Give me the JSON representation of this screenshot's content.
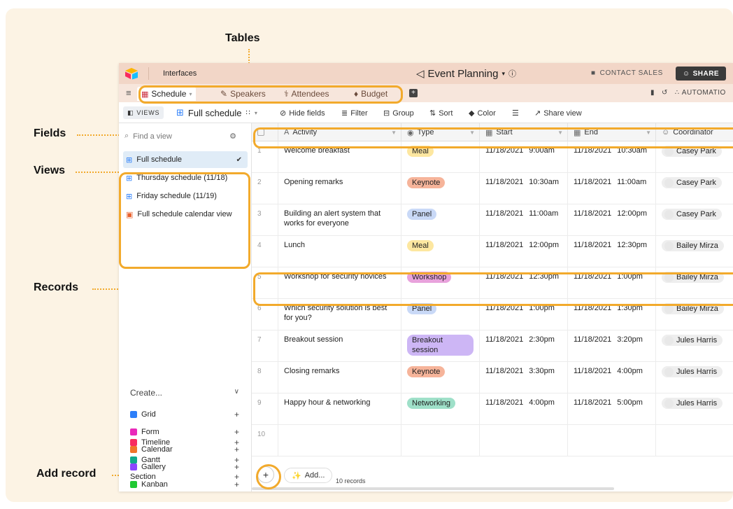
{
  "annotations": {
    "tables": "Tables",
    "fields": "Fields",
    "views": "Views",
    "records": "Records",
    "add_record": "Add record"
  },
  "header": {
    "interfaces": "Interfaces",
    "base_name": "Event Planning",
    "contact_sales": "CONTACT SALES",
    "share": "SHARE"
  },
  "tables": [
    "Schedule",
    "Speakers",
    "Attendees",
    "Budget"
  ],
  "toolbar_right": {
    "automations": "AUTOMATIO"
  },
  "viewbar": {
    "views": "VIEWS",
    "view_name": "Full schedule",
    "hide_fields": "Hide fields",
    "filter": "Filter",
    "group": "Group",
    "sort": "Sort",
    "color": "Color",
    "share_view": "Share view"
  },
  "sidebar": {
    "find_placeholder": "Find a view",
    "views": [
      "Full schedule",
      "Thursday schedule (11/18)",
      "Friday schedule (11/19)",
      "Full schedule calendar view"
    ],
    "create_label": "Create...",
    "create_items": [
      "Grid",
      "Form",
      "Calendar",
      "Gallery",
      "Kanban",
      "Timeline",
      "Gantt",
      "Section"
    ]
  },
  "columns": [
    "Activity",
    "Type",
    "Start",
    "End",
    "Coordinator"
  ],
  "rows": [
    {
      "n": "1",
      "activity": "Welcome breakfast",
      "type": "Meal",
      "start_d": "11/18/2021",
      "start_t": "9:00am",
      "end_d": "11/18/2021",
      "end_t": "10:30am",
      "coord": "Casey Park"
    },
    {
      "n": "2",
      "activity": "Opening remarks",
      "type": "Keynote",
      "start_d": "11/18/2021",
      "start_t": "10:30am",
      "end_d": "11/18/2021",
      "end_t": "11:00am",
      "coord": "Casey Park"
    },
    {
      "n": "3",
      "activity": "Building an alert system that works for everyone",
      "type": "Panel",
      "start_d": "11/18/2021",
      "start_t": "11:00am",
      "end_d": "11/18/2021",
      "end_t": "12:00pm",
      "coord": "Casey Park"
    },
    {
      "n": "4",
      "activity": "Lunch",
      "type": "Meal",
      "start_d": "11/18/2021",
      "start_t": "12:00pm",
      "end_d": "11/18/2021",
      "end_t": "12:30pm",
      "coord": "Bailey Mirza"
    },
    {
      "n": "5",
      "activity": "Workshop for security novices",
      "type": "Workshop",
      "start_d": "11/18/2021",
      "start_t": "12:30pm",
      "end_d": "11/18/2021",
      "end_t": "1:00pm",
      "coord": "Bailey Mirza"
    },
    {
      "n": "6",
      "activity": "Which security solution is best for you?",
      "type": "Panel",
      "start_d": "11/18/2021",
      "start_t": "1:00pm",
      "end_d": "11/18/2021",
      "end_t": "1:30pm",
      "coord": "Bailey Mirza"
    },
    {
      "n": "7",
      "activity": "Breakout session",
      "type": "Breakout session",
      "start_d": "11/18/2021",
      "start_t": "2:30pm",
      "end_d": "11/18/2021",
      "end_t": "3:20pm",
      "coord": "Jules Harris"
    },
    {
      "n": "8",
      "activity": "Closing remarks",
      "type": "Keynote",
      "start_d": "11/18/2021",
      "start_t": "3:30pm",
      "end_d": "11/18/2021",
      "end_t": "4:00pm",
      "coord": "Jules Harris"
    },
    {
      "n": "9",
      "activity": "Happy hour & networking",
      "type": "Networking",
      "start_d": "11/18/2021",
      "start_t": "4:00pm",
      "end_d": "11/18/2021",
      "end_t": "5:00pm",
      "coord": "Jules Harris"
    },
    {
      "n": "10",
      "activity": "",
      "type": "",
      "start_d": "",
      "start_t": "",
      "end_d": "",
      "end_t": "",
      "coord": ""
    }
  ],
  "footer": {
    "add_label": "+",
    "add_more": "Add...",
    "record_count": "10 records"
  },
  "type_colors": {
    "Meal": "#fde7a0",
    "Keynote": "#f6b49a",
    "Panel": "#c9d9f7",
    "Workshop": "#e8a2dc",
    "Breakout session": "#cdb6f5",
    "Networking": "#9fe0c9"
  },
  "colors": {
    "accent": "#f2aa2c",
    "header_bg": "#f2d6c7",
    "tables_bg": "#f7e6dc",
    "canvas_bg": "#fcf3e4"
  }
}
